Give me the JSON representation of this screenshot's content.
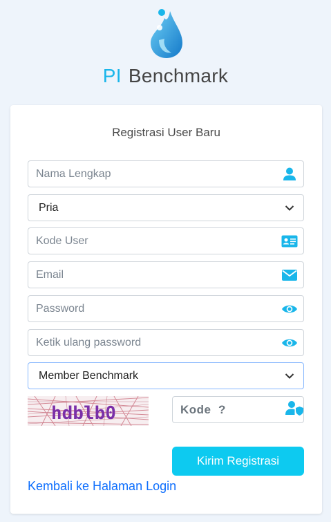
{
  "brand": {
    "prefix": "PI",
    "name": "Benchmark"
  },
  "form": {
    "title": "Registrasi User Baru",
    "full_name_placeholder": "Nama Lengkap",
    "gender_selected": "Pria",
    "user_code_placeholder": "Kode User",
    "email_placeholder": "Email",
    "password_placeholder": "Password",
    "confirm_password_placeholder": "Ketik ulang password",
    "member_type_selected": "Member Benchmark",
    "captcha_text": "hdblb0",
    "captcha_input_placeholder": "Kode  ?",
    "submit_label": "Kirim Registrasi",
    "back_link": "Kembali ke Halaman Login"
  },
  "colors": {
    "accent": "#0dcaf0",
    "link": "#0d6efd",
    "background": "#eef4fb"
  }
}
